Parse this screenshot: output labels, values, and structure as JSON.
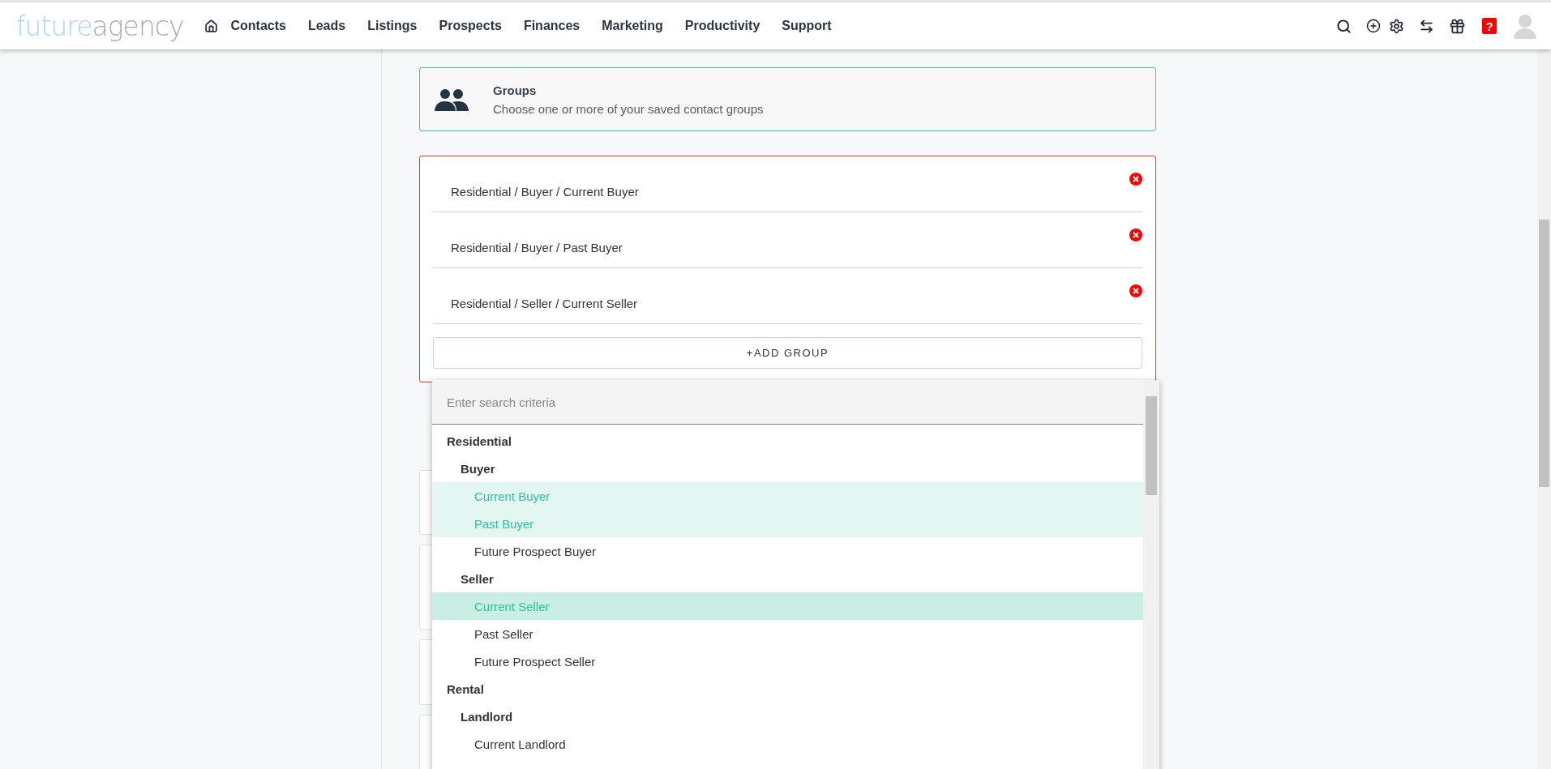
{
  "brand": {
    "lead": "future",
    "tail": "agency"
  },
  "nav": [
    "Contacts",
    "Leads",
    "Listings",
    "Prospects",
    "Finances",
    "Marketing",
    "Productivity",
    "Support"
  ],
  "help_badge": "?",
  "groups_card": {
    "title": "Groups",
    "subtitle": "Choose one or more of your saved contact groups"
  },
  "chosen_groups": [
    "Residential / Buyer / Current Buyer",
    "Residential / Buyer / Past Buyer",
    "Residential / Seller / Current Seller"
  ],
  "add_button": "+ADD GROUP",
  "dropdown": {
    "placeholder": "Enter search criteria",
    "options": [
      {
        "label": "Residential",
        "children": [
          {
            "label": "Buyer",
            "children": [
              {
                "label": "Current Buyer",
                "selected": true,
                "highlighted": false
              },
              {
                "label": "Past Buyer",
                "selected": true,
                "highlighted": false
              },
              {
                "label": "Future Prospect Buyer",
                "selected": false,
                "highlighted": false
              }
            ]
          },
          {
            "label": "Seller",
            "children": [
              {
                "label": "Current Seller",
                "selected": true,
                "highlighted": true
              },
              {
                "label": "Past Seller",
                "selected": false,
                "highlighted": false
              },
              {
                "label": "Future Prospect Seller",
                "selected": false,
                "highlighted": false
              }
            ]
          }
        ]
      },
      {
        "label": "Rental",
        "children": [
          {
            "label": "Landlord",
            "children": [
              {
                "label": "Current Landlord",
                "selected": false,
                "highlighted": false
              }
            ]
          }
        ]
      }
    ]
  }
}
